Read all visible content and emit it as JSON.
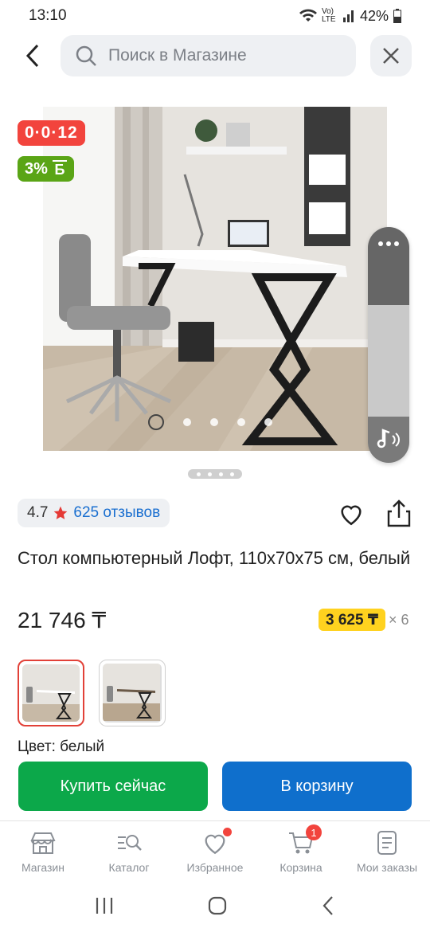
{
  "status": {
    "time": "13:10",
    "network": "Vo) LTE",
    "battery": "42%"
  },
  "search": {
    "placeholder": "Поиск в Магазине"
  },
  "badges": {
    "timer": "0·0·12",
    "bonus_percent": "3%",
    "bonus_symbol": "Б"
  },
  "product": {
    "rating": "4.7",
    "reviews": "625 отзывов",
    "title": "Стол компьютерный Лофт, 110x70x75 см, белый",
    "price": "21 746 ₸",
    "installment_price": "3 625 ₸",
    "installment_months": "× 6",
    "color_label": "Цвет: белый"
  },
  "actions": {
    "buy_now": "Купить сейчас",
    "add_to_cart": "В корзину"
  },
  "tabbar": {
    "items": [
      {
        "label": "Магазин",
        "icon": "shop-icon"
      },
      {
        "label": "Каталог",
        "icon": "catalog-search-icon"
      },
      {
        "label": "Избранное",
        "icon": "heart-icon"
      },
      {
        "label": "Корзина",
        "icon": "cart-icon",
        "badge": "1"
      },
      {
        "label": "Мои заказы",
        "icon": "orders-icon"
      }
    ]
  },
  "colors": {
    "accent_green": "#0ca84a",
    "accent_blue": "#0f6fcc",
    "red": "#f2443d",
    "yellow": "#ffd21f"
  }
}
